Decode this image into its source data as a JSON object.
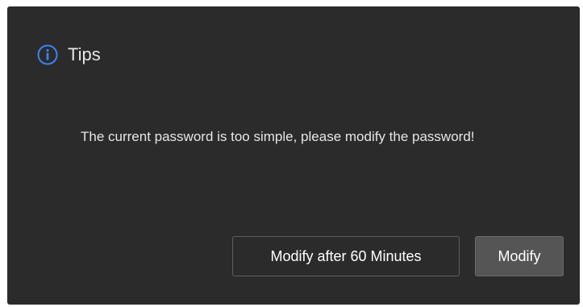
{
  "dialog": {
    "title": "Tips",
    "icon": "info-icon",
    "message": "The current password is too simple, please modify the password!",
    "buttons": {
      "later_label": "Modify after 60 Minutes",
      "modify_label": "Modify"
    }
  },
  "colors": {
    "background": "#2b2b2b",
    "accent": "#3b82f6",
    "text": "#e6e6e6",
    "primary_button": "#555555"
  }
}
